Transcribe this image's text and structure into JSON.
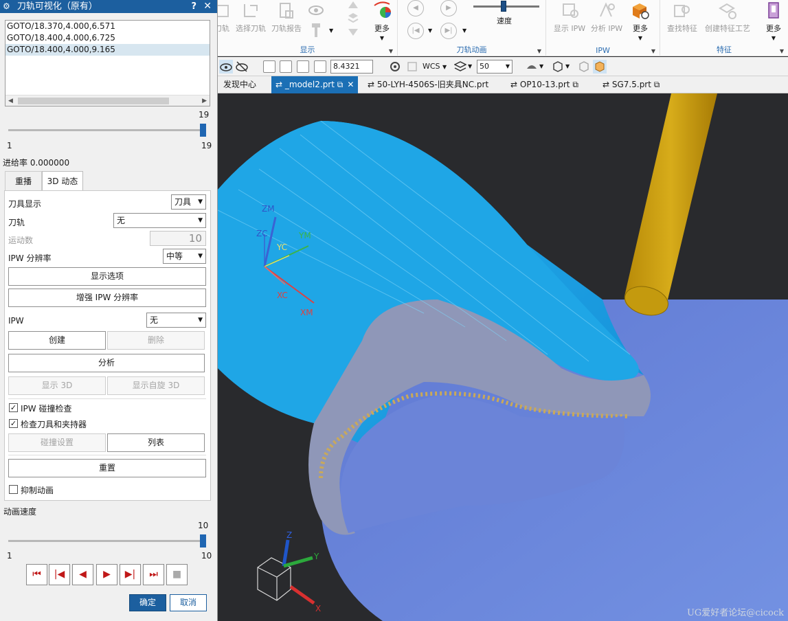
{
  "dialog": {
    "title": "刀轨可视化（原有）",
    "help": "?",
    "close": "✕",
    "list": [
      "GOTO/18.370,4.000,6.571",
      "GOTO/18.400,4.000,6.725",
      "GOTO/18.400,4.000,9.165"
    ],
    "slider1": {
      "top_value": "19",
      "min": "1",
      "max": "19",
      "value": 19
    },
    "feed_rate": "进给率 0.000000",
    "tabs": [
      "重播",
      "3D 动态"
    ],
    "active_tab": "3D 动态",
    "tool_display_label": "刀具显示",
    "tool_display_value": "刀具",
    "toolpath_label": "刀轨",
    "toolpath_value": "无",
    "motion_count_label": "运动数",
    "motion_count_value": "10",
    "ipw_res_label": "IPW 分辨率",
    "ipw_res_value": "中等",
    "display_options": "显示选项",
    "enhance_ipw": "增强 IPW 分辨率",
    "ipw_label": "IPW",
    "ipw_value": "无",
    "create": "创建",
    "delete": "删除",
    "analyze": "分析",
    "show_3d": "显示 3D",
    "show_spin_3d": "显示自旋 3D",
    "ipw_collision": "IPW 碰撞检查",
    "check_tool_holder": "检查刀具和夹持器",
    "collision_settings": "碰撞设置",
    "list_btn": "列表",
    "reset": "重置",
    "suppress_anim": "抑制动画",
    "anim_speed_label": "动画速度",
    "slider2": {
      "top_value": "10",
      "min": "1",
      "max": "10",
      "value": 10
    },
    "playback": [
      "⏮",
      "|◀",
      "◀",
      "▶",
      "▶|",
      "⏭",
      "■"
    ],
    "ok": "确定",
    "cancel": "取消"
  },
  "ribbon": {
    "display_group": {
      "label": "显示",
      "buttons": [
        "刀轨",
        "选择刀轨",
        "刀轨报告",
        "更多"
      ]
    },
    "animation_group": {
      "label": "刀轨动画",
      "speed": "速度"
    },
    "ipw_group": {
      "label": "IPW",
      "buttons": [
        "显示 IPW",
        "分析 IPW",
        "更多"
      ]
    },
    "feature_group": {
      "label": "特征",
      "buttons": [
        "查找特征",
        "创建特征工艺",
        "更多"
      ]
    }
  },
  "toolbar": {
    "zoom_value": "8.4321",
    "csys": "WCS",
    "layer_value": "50"
  },
  "file_tabs": [
    {
      "label": "发现中心",
      "active": false
    },
    {
      "label": "_model2.prt",
      "active": true
    },
    {
      "label": "50-LYH-4506S-旧夹具NC.prt",
      "active": false
    },
    {
      "label": "OP10-13.prt",
      "active": false
    },
    {
      "label": "SG7.5.prt",
      "active": false
    }
  ],
  "viewport": {
    "axes_labels": {
      "zm": "ZM",
      "zc": "ZC",
      "yc": "YC",
      "ym": "YM",
      "xc": "XC",
      "xm": "XM"
    },
    "triad": {
      "z": "Z",
      "y": "Y",
      "x": "X"
    },
    "watermark": "UG爱好者论坛@cicock"
  },
  "colors": {
    "title_blue": "#1c5f9f",
    "active_tab_blue": "#1b6fb5",
    "part_cyan": "#1fa6e6",
    "part_purple": "#6a86dc",
    "tool_gold": "#c99c10"
  }
}
